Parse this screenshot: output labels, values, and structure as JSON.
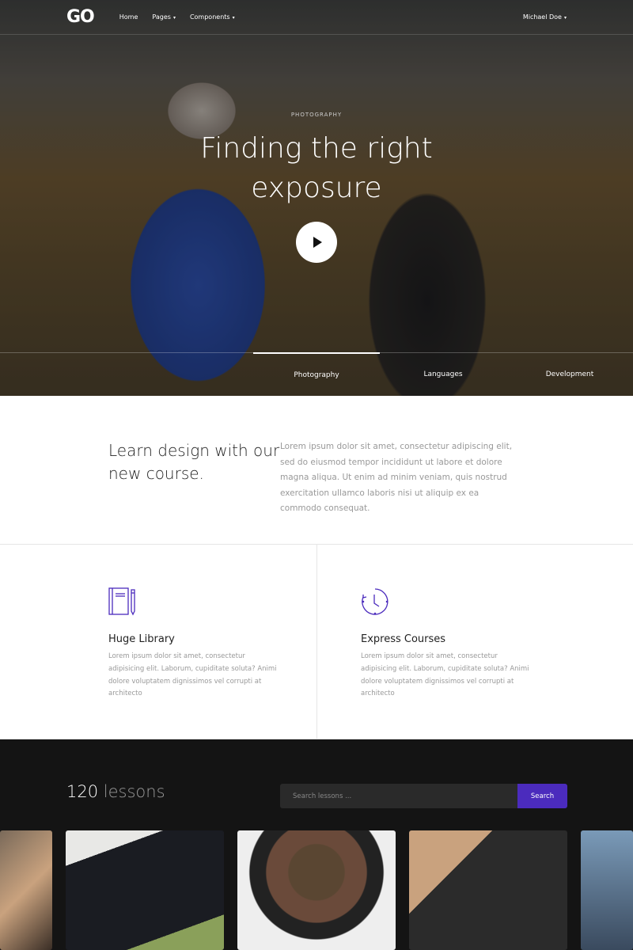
{
  "nav": {
    "logo": "GO",
    "items": [
      {
        "label": "Home"
      },
      {
        "label": "Pages",
        "caret": "▾"
      },
      {
        "label": "Components",
        "caret": "▾"
      }
    ],
    "user": "Michael Doe",
    "user_caret": "▾"
  },
  "hero": {
    "kicker": "PHOTOGRAPHY",
    "title_line1": "Finding the right",
    "title_line2": "exposure",
    "play_icon": "play-icon",
    "tabs": [
      {
        "label": "Photography",
        "active": true
      },
      {
        "label": "Languages"
      },
      {
        "label": "Development"
      }
    ]
  },
  "intro": {
    "heading": "Learn design with our new course.",
    "text": "Lorem ipsum dolor sit amet, consectetur adipiscing elit, sed do eiusmod tempor incididunt ut labore et dolore magna aliqua. Ut enim ad minim veniam, quis nostrud exercitation ullamco laboris nisi ut aliquip ex ea commodo consequat."
  },
  "features": [
    {
      "icon": "notebook-pencil-icon",
      "title": "Huge Library",
      "text": "Lorem ipsum dolor sit amet, consectetur adipisicing elit. Laborum, cupiditate soluta? Animi dolore voluptatem dignissimos vel corrupti at architecto"
    },
    {
      "icon": "clock-icon",
      "title": "Express Courses",
      "text": "Lorem ipsum dolor sit amet, consectetur adipisicing elit. Laborum, cupiditate soluta? Animi dolore voluptatem dignissimos vel corrupti at architecto"
    }
  ],
  "lessons": {
    "count": "120",
    "count_label": "lessons",
    "search_placeholder": "Search lessons ...",
    "search_button": "Search"
  },
  "colors": {
    "accent": "#4b2bbd",
    "dark_bg": "#141414"
  }
}
